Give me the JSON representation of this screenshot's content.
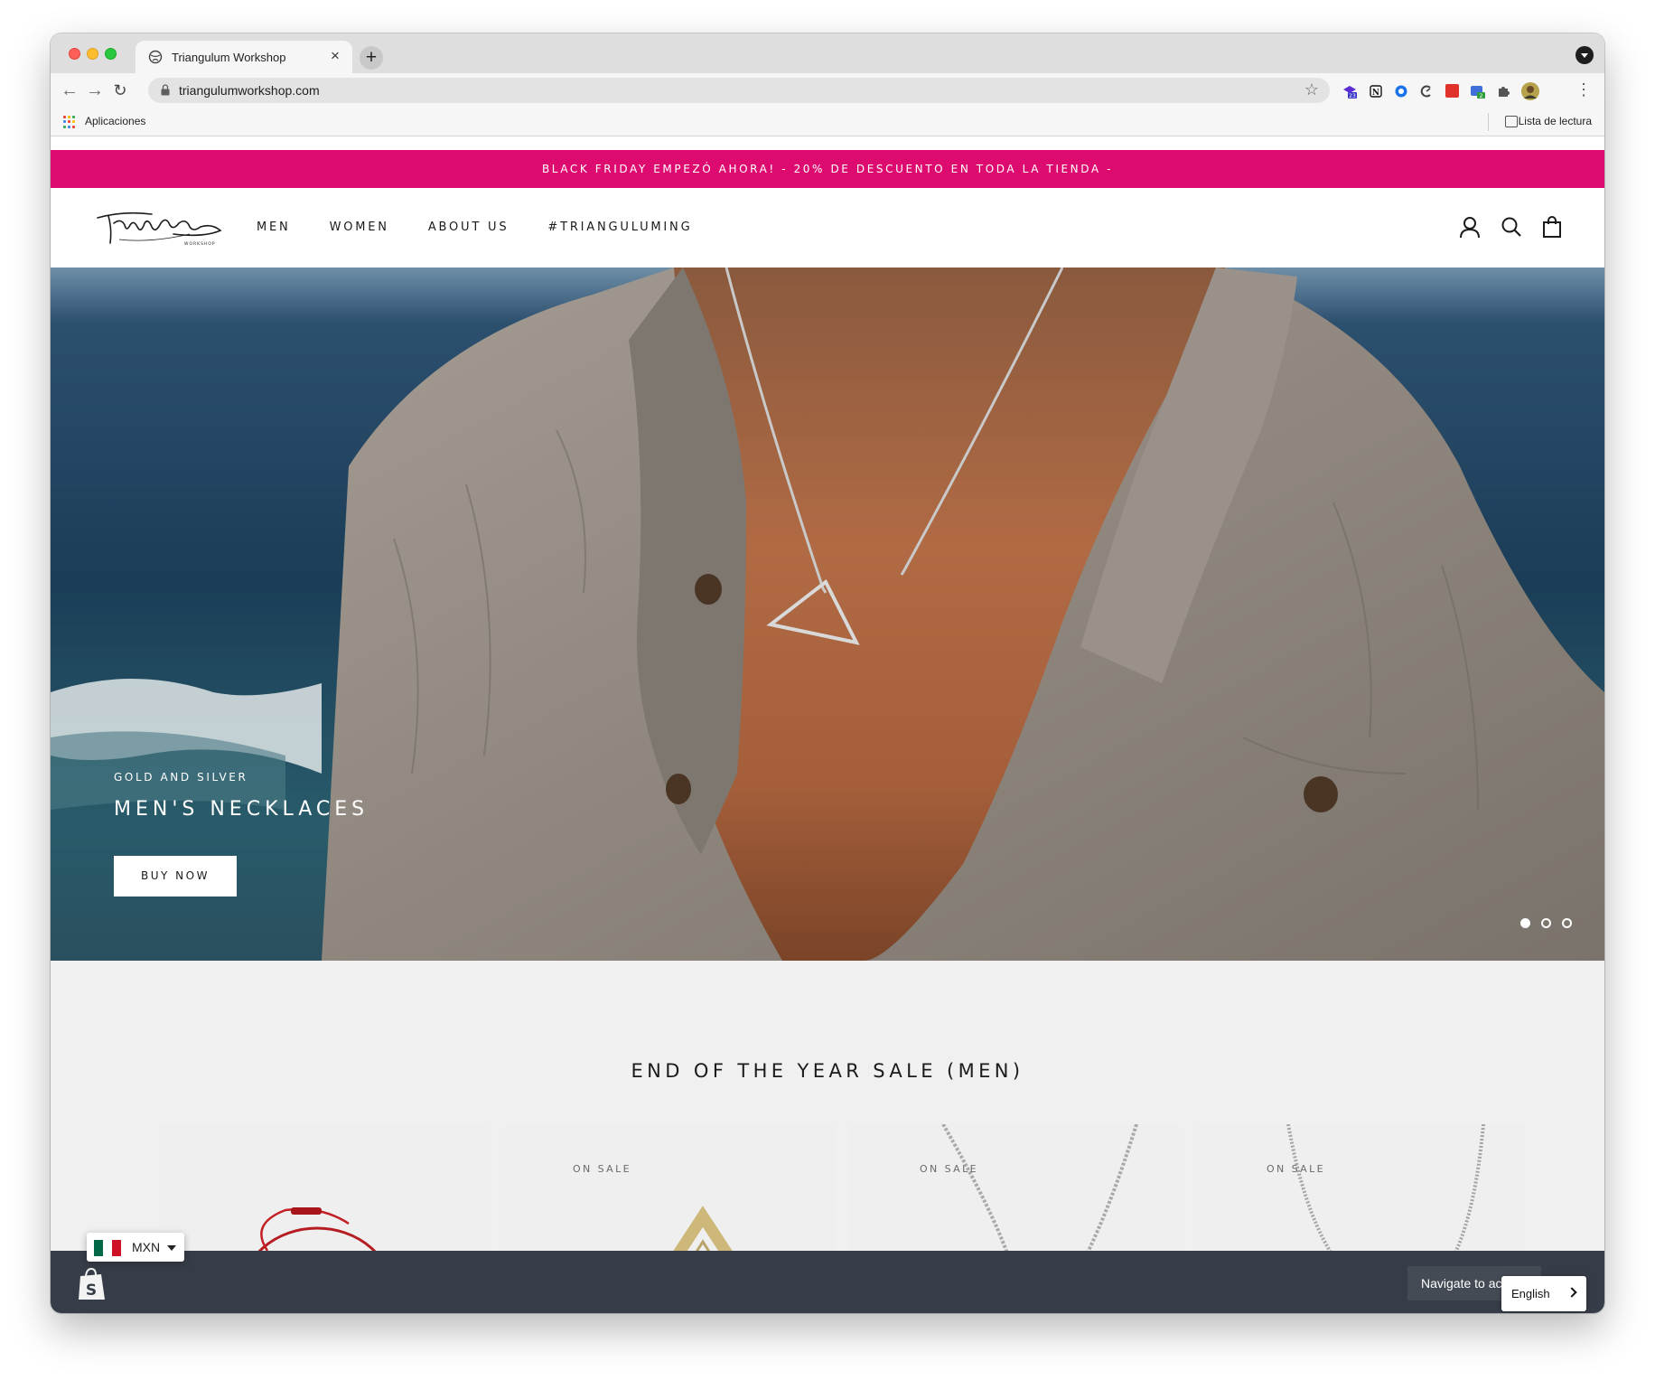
{
  "browser": {
    "tab_title": "Triangulum Workshop",
    "tab_close": "×",
    "new_tab": "+",
    "url": "triangulumworkshop.com",
    "bookmarks": {
      "apps_label": "Aplicaciones",
      "reading_list_label": "Lista de lectura"
    },
    "extension_badges": [
      "23",
      "2"
    ]
  },
  "announcement": {
    "text": "BLACK FRIDAY EMPEZÓ AHORA! - 20% DE DESCUENTO EN TODA LA TIENDA -",
    "background": "#dd0b6f"
  },
  "header": {
    "logo_icon": "triangulum-workshop-logo",
    "nav": [
      "MEN",
      "WOMEN",
      "ABOUT US",
      "#TRIANGULUMING"
    ],
    "icons": [
      "account-icon",
      "search-icon",
      "cart-icon"
    ]
  },
  "hero": {
    "subtitle": "GOLD AND SILVER",
    "title": "MEN'S NECKLACES",
    "button": "BUY NOW",
    "slides": 3,
    "active_slide": 1
  },
  "sale": {
    "title": "END OF THE YEAR SALE (MEN)",
    "products": [
      {
        "badge": "",
        "image": "red-string-bracelet"
      },
      {
        "badge": "ON SALE",
        "image": "gold-triangle-pendant"
      },
      {
        "badge": "ON SALE",
        "image": "silver-curb-chain"
      },
      {
        "badge": "ON SALE",
        "image": "silver-rope-chain"
      }
    ]
  },
  "currency": {
    "code": "MXN",
    "flag": "mexico-flag"
  },
  "navigate_button": "Navigate to ac",
  "language": {
    "label": "English"
  }
}
